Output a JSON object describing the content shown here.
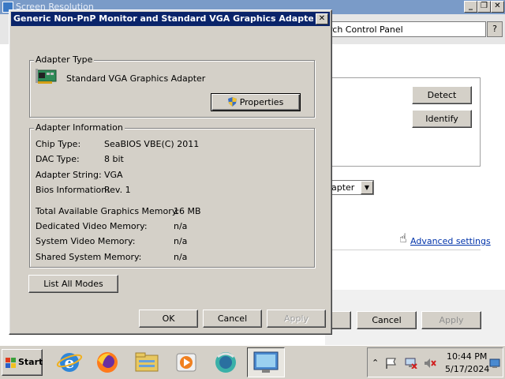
{
  "background_window": {
    "title": "Screen Resolution",
    "search_text": "rch Control Panel",
    "buttons": {
      "detect": "Detect",
      "identify": "Identify",
      "cancel": "Cancel",
      "apply": "Apply"
    },
    "select_value": "dapter",
    "advanced_link": "Advanced settings"
  },
  "dialog": {
    "title": "Generic Non-PnP Monitor and Standard VGA Graphics Adapter Pro...",
    "adapter_type": {
      "legend": "Adapter Type",
      "name": "Standard VGA Graphics Adapter",
      "properties_button": "Properties"
    },
    "adapter_info": {
      "legend": "Adapter Information",
      "rows": [
        {
          "label": "Chip Type:",
          "value": "SeaBIOS VBE(C) 2011"
        },
        {
          "label": "DAC Type:",
          "value": "8 bit"
        },
        {
          "label": "Adapter String:",
          "value": "VGA"
        },
        {
          "label": "Bios Information:",
          "value": "Rev. 1"
        }
      ],
      "memory_rows": [
        {
          "label": "Total Available Graphics Memory:",
          "value": "16 MB"
        },
        {
          "label": "Dedicated Video Memory:",
          "value": "n/a"
        },
        {
          "label": "System Video Memory:",
          "value": "n/a"
        },
        {
          "label": "Shared System Memory:",
          "value": "n/a"
        }
      ]
    },
    "list_all_modes": "List All Modes",
    "ok": "OK",
    "cancel": "Cancel",
    "apply": "Apply"
  },
  "taskbar": {
    "start": "Start",
    "icons": [
      "internet-explorer-icon",
      "firefox-icon",
      "file-explorer-icon",
      "media-player-icon",
      "browser-icon",
      "control-panel-icon"
    ],
    "clock_time": "10:44 PM",
    "clock_date": "5/17/2024"
  }
}
